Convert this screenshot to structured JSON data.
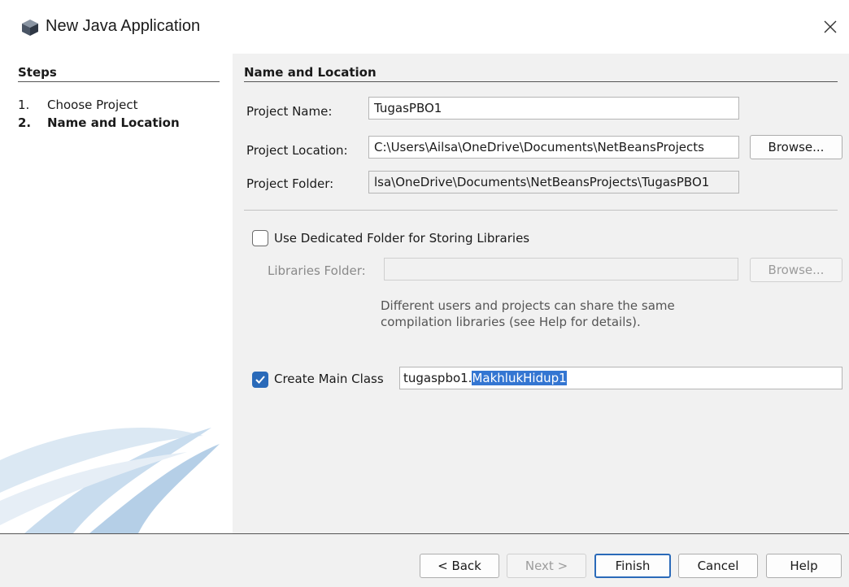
{
  "window": {
    "title": "New Java Application",
    "icon": "cube-icon",
    "close_glyph": "✕"
  },
  "steps": {
    "heading": "Steps",
    "items": [
      {
        "num": "1.",
        "label": "Choose Project",
        "current": false
      },
      {
        "num": "2.",
        "label": "Name and Location",
        "current": true
      }
    ]
  },
  "main": {
    "section_title": "Name and Location",
    "project_name": {
      "label": "Project Name:",
      "value": "TugasPBO1"
    },
    "project_location": {
      "label": "Project Location:",
      "value": "C:\\Users\\Ailsa\\OneDrive\\Documents\\NetBeansProjects",
      "browse_label": "Browse..."
    },
    "project_folder": {
      "label": "Project Folder:",
      "value": "lsa\\OneDrive\\Documents\\NetBeansProjects\\TugasPBO1"
    },
    "dedicated_folder": {
      "label": "Use Dedicated Folder for Storing Libraries",
      "checked": false
    },
    "libraries_folder": {
      "label": "Libraries Folder:",
      "value": "",
      "browse_label": "Browse..."
    },
    "hint_line1": "Different users and projects can share the same",
    "hint_line2": "compilation libraries (see Help for details).",
    "main_class": {
      "label": "Create Main Class",
      "checked": true,
      "prefix": "tugaspbo1.",
      "selected": "MakhlukHidup1"
    }
  },
  "buttons": {
    "back": "< Back",
    "next": "Next >",
    "finish": "Finish",
    "cancel": "Cancel",
    "help": "Help"
  },
  "colors": {
    "accent": "#2a6ab9",
    "selection": "#3476d2",
    "panel_bg": "#f1f1f1"
  }
}
